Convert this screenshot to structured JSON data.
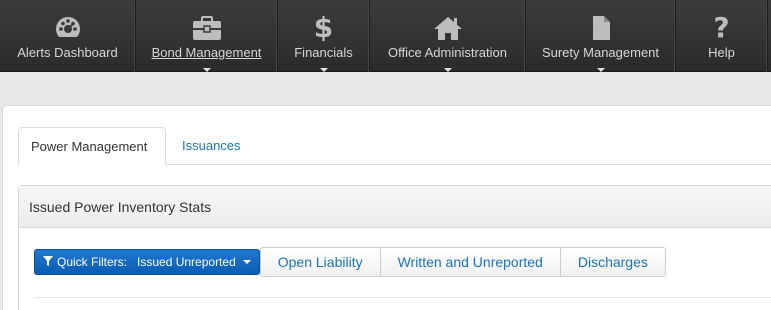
{
  "nav": {
    "items": [
      {
        "label": "Alerts Dashboard",
        "icon": "dashboard-gauge-icon",
        "has_dropdown": false,
        "active": false
      },
      {
        "label": "Bond Management",
        "icon": "briefcase-icon",
        "has_dropdown": true,
        "active": true
      },
      {
        "label": "Financials",
        "icon": "dollar-sign-icon",
        "has_dropdown": true,
        "active": false
      },
      {
        "label": "Office Administration",
        "icon": "home-icon",
        "has_dropdown": true,
        "active": false
      },
      {
        "label": "Surety Management",
        "icon": "document-icon",
        "has_dropdown": true,
        "active": false
      },
      {
        "label": "Help",
        "icon": "question-mark-icon",
        "has_dropdown": false,
        "active": false
      }
    ]
  },
  "tabs": [
    {
      "label": "Power Management",
      "active": true
    },
    {
      "label": "Issuances",
      "active": false
    }
  ],
  "stats": {
    "title": "Issued Power Inventory Stats"
  },
  "filters": {
    "quick_filter_label": "Quick Filters:",
    "quick_filter_selected": "Issued Unreported",
    "buttons": [
      "Open Liability",
      "Written and Unreported",
      "Discharges"
    ]
  },
  "colors": {
    "nav_bg": "#333333",
    "nav_text": "#d6d6d6",
    "link_blue": "#1a74b8",
    "primary_button": "#1267c4"
  }
}
